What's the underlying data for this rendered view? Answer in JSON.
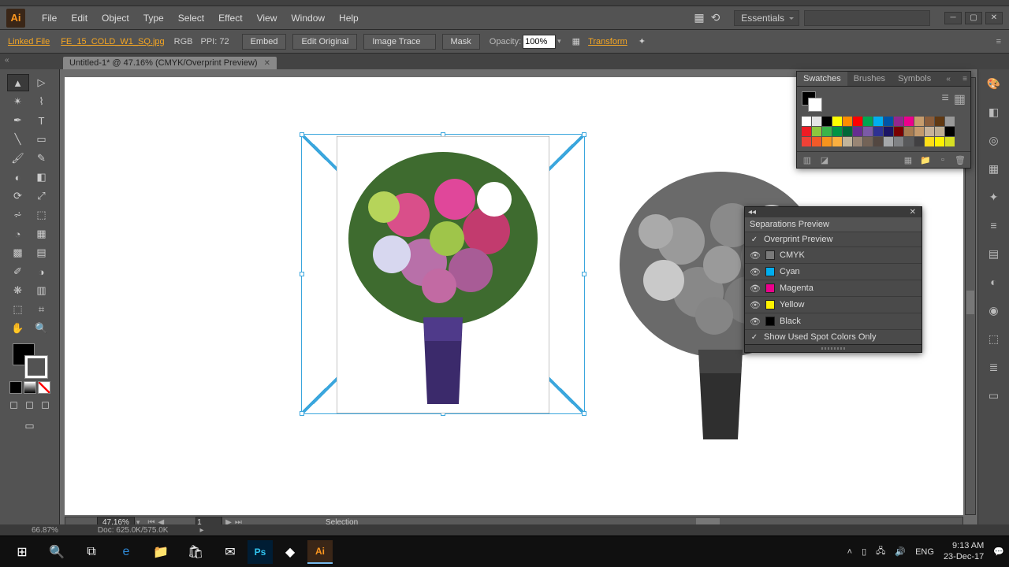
{
  "menubar": {
    "items": [
      "File",
      "Edit",
      "Object",
      "Type",
      "Select",
      "Effect",
      "View",
      "Window",
      "Help"
    ],
    "workspace": "Essentials",
    "search_placeholder": ""
  },
  "controlbar": {
    "linked_file": "Linked File",
    "filename": "FE_15_COLD_W1_SQ.jpg",
    "rgb": "RGB",
    "ppi": "PPI: 72",
    "embed": "Embed",
    "edit_original": "Edit Original",
    "image_trace": "Image Trace",
    "mask": "Mask",
    "opacity_label": "Opacity:",
    "opacity_value": "100%",
    "transform": "Transform"
  },
  "doc_tab": {
    "label": "Untitled-1* @ 47.16% (CMYK/Overprint Preview)"
  },
  "status": {
    "zoom": "47.16%",
    "page": "1",
    "selection": "Selection",
    "doc": "Doc: 625.0K/575.0K",
    "mem": "66.87%"
  },
  "swatches_panel": {
    "tabs": [
      "Swatches",
      "Brushes",
      "Symbols"
    ],
    "colors": [
      "#ffffff",
      "#e5e5e5",
      "#000000",
      "#ffff00",
      "#ff8c00",
      "#ff0000",
      "#00a651",
      "#00aeef",
      "#0054a6",
      "#92278f",
      "#ec008c",
      "#c69c6d",
      "#8b5e3c",
      "#603913",
      "#999999",
      "#ed1c24",
      "#8dc63e",
      "#39b54a",
      "#009444",
      "#006838",
      "#662d91",
      "#7b5aa6",
      "#2e3192",
      "#1b1464",
      "#790000",
      "#a67c52",
      "#c49a6c",
      "#c7b299",
      "#beae94",
      "#000000",
      "#ef4136",
      "#f15a29",
      "#f7941d",
      "#fbb040",
      "#c2b59b",
      "#998675",
      "#736357",
      "#534741",
      "#a6a8ab",
      "#808285",
      "#58595b",
      "#414042",
      "#ffde17",
      "#fff200",
      "#d7df23"
    ]
  },
  "separations": {
    "title": "Separations Preview",
    "overprint": "Overprint Preview",
    "items": [
      {
        "name": "CMYK",
        "color": "#7a7a7a"
      },
      {
        "name": "Cyan",
        "color": "#00aeef"
      },
      {
        "name": "Magenta",
        "color": "#ec008c"
      },
      {
        "name": "Yellow",
        "color": "#fff200"
      },
      {
        "name": "Black",
        "color": "#000000"
      }
    ],
    "spot": "Show Used Spot Colors Only"
  },
  "taskbar": {
    "lang": "ENG",
    "time": "9:13 AM",
    "date": "23-Dec-17"
  }
}
